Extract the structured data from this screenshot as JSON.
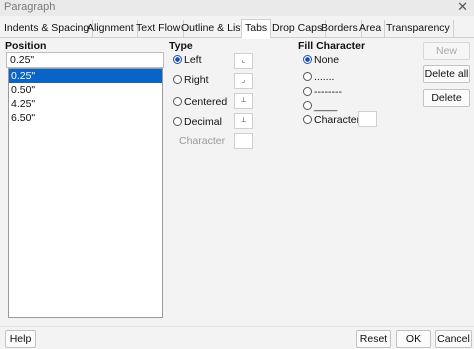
{
  "window": {
    "title": "Paragraph",
    "close_glyph": "✕"
  },
  "tabs": [
    {
      "label": "Indents & Spacing"
    },
    {
      "label": "Alignment"
    },
    {
      "label": "Text Flow"
    },
    {
      "label": "Outline & List"
    },
    {
      "label": "Tabs",
      "active": true
    },
    {
      "label": "Drop Caps"
    },
    {
      "label": "Borders"
    },
    {
      "label": "Area"
    },
    {
      "label": "Transparency"
    }
  ],
  "position": {
    "heading": "Position",
    "input_value": "0.25\"",
    "items": [
      "0.25\"",
      "0.50\"",
      "4.25\"",
      "6.50\""
    ],
    "selected_index": 0
  },
  "type": {
    "heading": "Type",
    "options": [
      {
        "label": "Left",
        "checked": true
      },
      {
        "label": "Right",
        "checked": false
      },
      {
        "label": "Centered",
        "checked": false
      },
      {
        "label": "Decimal",
        "checked": false
      }
    ],
    "character_label": "Character"
  },
  "fill": {
    "heading": "Fill Character",
    "options": [
      {
        "label": "None",
        "checked": true
      },
      {
        "label": ".......",
        "checked": false
      },
      {
        "label": "--------",
        "checked": false
      },
      {
        "label": "____",
        "checked": false
      },
      {
        "label": "Character",
        "checked": false
      }
    ]
  },
  "buttons": {
    "new": "New",
    "delete_all": "Delete all",
    "delete": "Delete",
    "help": "Help",
    "reset": "Reset",
    "ok": "OK",
    "cancel": "Cancel"
  },
  "colors": {
    "selection": "#0a64c8",
    "radio_accent": "#1a4fb0"
  }
}
